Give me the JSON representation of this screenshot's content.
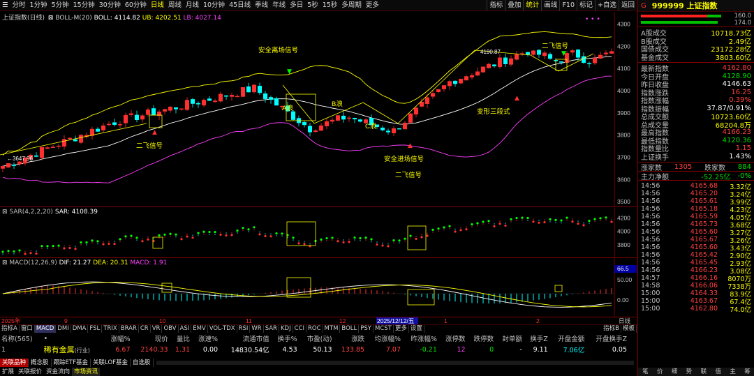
{
  "toolbar": {
    "periods": [
      "分时",
      "1分钟",
      "5分钟",
      "15分钟",
      "30分钟",
      "60分钟",
      "日线",
      "周线",
      "月线",
      "10分钟",
      "45日线",
      "季线",
      "年线",
      "多日",
      "5秒",
      "15秒",
      "多周期",
      "更多"
    ],
    "active_period": "日线",
    "tools": [
      "指标",
      "叠加",
      "统计",
      "画线",
      "F10",
      "标记",
      "+自选",
      "返回"
    ],
    "active_tool": "统计"
  },
  "main": {
    "title": "上证指数(日线)",
    "indicator": "BOLL-M(20)",
    "boll": "BOLL: 4114.82",
    "ub": "UB: 4202.51",
    "lb": "LB: 4027.14",
    "y_labels": [
      "4300",
      "4200",
      "4100",
      "4000",
      "3900",
      "3800",
      "3700",
      "3600",
      "3500"
    ],
    "low_mark": "3647.96",
    "high_mark": "4190.87",
    "annotations": {
      "leave": "安全离场信号",
      "feifei1": "二飞信号",
      "a": "A浪",
      "b": "B浪",
      "c": "C浪",
      "enter": "安全进场信号",
      "feifei2": "二飞信号",
      "bianxing": "变形三段式",
      "feifei3": "二飞信号"
    }
  },
  "sar": {
    "title": "SAR(4,2,2,20)",
    "value": "SAR: 4108.39",
    "y_labels": [
      "4200",
      "4000",
      "3800"
    ]
  },
  "macd": {
    "title": "MACD(12,26,9)",
    "dif": "DIF: 21.27",
    "dea": "DEA: 20.31",
    "macd": "MACD: 1.91",
    "y_labels": [
      "66.5",
      "50.00",
      "0.00"
    ]
  },
  "xaxis": {
    "labels": [
      "2025年",
      "9",
      "10",
      "11",
      "12",
      "2025/12/12/五",
      "1",
      "2"
    ],
    "right": "日线"
  },
  "bottom_tabs": {
    "items": [
      "指标A",
      "窗口",
      "MACD",
      "DMI",
      "DMA",
      "FSL",
      "TRIX",
      "BRAR",
      "CR",
      "VR",
      "OBV",
      "ASI",
      "EMV",
      "VOL-TDX",
      "RSI",
      "WR",
      "SAR",
      "KDJ",
      "CCI",
      "ROC",
      "MTM",
      "BOLL",
      "PSY",
      "MCST",
      "更多",
      "设置"
    ],
    "active": "MACD",
    "right": [
      "指标B",
      "模板"
    ]
  },
  "quote_table": {
    "headers": [
      "名称(565)",
      "•",
      "涨幅%",
      "现价",
      "量比",
      "涨速%",
      "流通市值",
      "换手%",
      "市盈(动)",
      "涨跌",
      "均涨幅%",
      "昨涨幅%",
      "涨停数",
      "跌停数",
      "封单额",
      "换手Z",
      "开盘金额",
      "开盘换手Z"
    ],
    "row": {
      "index": "1",
      "name": "稀有金属",
      "name_tag": "(行业)",
      "change_pct": "6.67",
      "price": "2140.33",
      "vol_ratio": "1.31",
      "speed": "0.00",
      "float_cap": "14830.54亿",
      "turnover": "4.53",
      "pe": "50.13",
      "change": "133.85",
      "avg_change": "7.07",
      "prev_change": "-0.21",
      "limit_up": "12",
      "limit_down": "0",
      "seal_amt": "-",
      "turnover_z": "9.11",
      "open_amt": "7.06亿",
      "open_turnover_z": "0.05"
    }
  },
  "link_tabs": [
    "关联品种",
    "概念股",
    "跟踪ETF基金",
    "关联LOF基金",
    "自选股"
  ],
  "status_bar": [
    "扩展",
    "关联报价",
    "资金流向",
    "市场资讯"
  ],
  "right_panel": {
    "g": "G",
    "title": "999999 上证指数",
    "bar_vals": [
      "160.0",
      "174.0"
    ],
    "stats": [
      {
        "k": "A股成交",
        "v": "10718.73亿",
        "c": "#ffff00"
      },
      {
        "k": "B股成交",
        "v": "2.49亿",
        "c": "#ffff00"
      },
      {
        "k": "国债成交",
        "v": "23172.28亿",
        "c": "#ffff00"
      },
      {
        "k": "基金成交",
        "v": "3803.60亿",
        "c": "#ffff00"
      }
    ],
    "quotes": [
      {
        "k": "最新指数",
        "v": "4162.80",
        "c": "#ff4040"
      },
      {
        "k": "今日开盘",
        "v": "4128.90",
        "c": "#00e000"
      },
      {
        "k": "昨日收盘",
        "v": "4146.63",
        "c": "#ffffff"
      },
      {
        "k": "指数涨跌",
        "v": "16.25",
        "c": "#ff4040"
      },
      {
        "k": "指数涨幅",
        "v": "0.39%",
        "c": "#ff4040"
      },
      {
        "k": "指数振幅",
        "v": "37.87/0.91%",
        "c": "#ffffff"
      },
      {
        "k": "总成交额",
        "v": "10723.60亿",
        "c": "#ffff00"
      },
      {
        "k": "总成交量",
        "v": "68204.8万",
        "c": "#ffff00"
      },
      {
        "k": "最高指数",
        "v": "4166.23",
        "c": "#ff4040"
      },
      {
        "k": "最低指数",
        "v": "4120.36",
        "c": "#00e000"
      },
      {
        "k": "指数量比",
        "v": "1.15",
        "c": "#ff4040"
      },
      {
        "k": "上证换手",
        "v": "1.43%",
        "c": "#ffffff"
      }
    ],
    "up_label": "涨家数",
    "up": "1305",
    "down_label": "跌家数",
    "down": "884",
    "flow_label": "主力净额",
    "flow": "-52.25亿",
    "flow_pct": "-0%",
    "ticks": [
      {
        "t": "14:56",
        "p": "4165.68",
        "v": "3.32亿"
      },
      {
        "t": "14:56",
        "p": "4165.20",
        "v": "3.24亿"
      },
      {
        "t": "14:56",
        "p": "4165.61",
        "v": "3.99亿"
      },
      {
        "t": "14:56",
        "p": "4165.18",
        "v": "4.23亿"
      },
      {
        "t": "14:56",
        "p": "4165.59",
        "v": "4.05亿"
      },
      {
        "t": "14:56",
        "p": "4165.73",
        "v": "3.68亿"
      },
      {
        "t": "14:56",
        "p": "4165.60",
        "v": "3.27亿"
      },
      {
        "t": "14:56",
        "p": "4165.67",
        "v": "3.26亿"
      },
      {
        "t": "14:56",
        "p": "4165.60",
        "v": "3.43亿"
      },
      {
        "t": "14:56",
        "p": "4165.42",
        "v": "2.90亿"
      },
      {
        "t": "14:56",
        "p": "4165.45",
        "v": "2.93亿"
      },
      {
        "t": "14:56",
        "p": "4166.23",
        "v": "3.08亿"
      },
      {
        "t": "14:57",
        "p": "4166.16",
        "v": "8070万"
      },
      {
        "t": "14:58",
        "p": "4166.06",
        "v": "7338万"
      },
      {
        "t": "15:00",
        "p": "4164.33",
        "v": "83.9亿"
      },
      {
        "t": "15:00",
        "p": "4163.67",
        "v": "67.4亿"
      },
      {
        "t": "15:00",
        "p": "4162.80",
        "v": "74.0亿"
      }
    ],
    "footer": [
      "笔",
      "价",
      "细",
      "势",
      "联",
      "值",
      "主",
      "筹"
    ]
  }
}
